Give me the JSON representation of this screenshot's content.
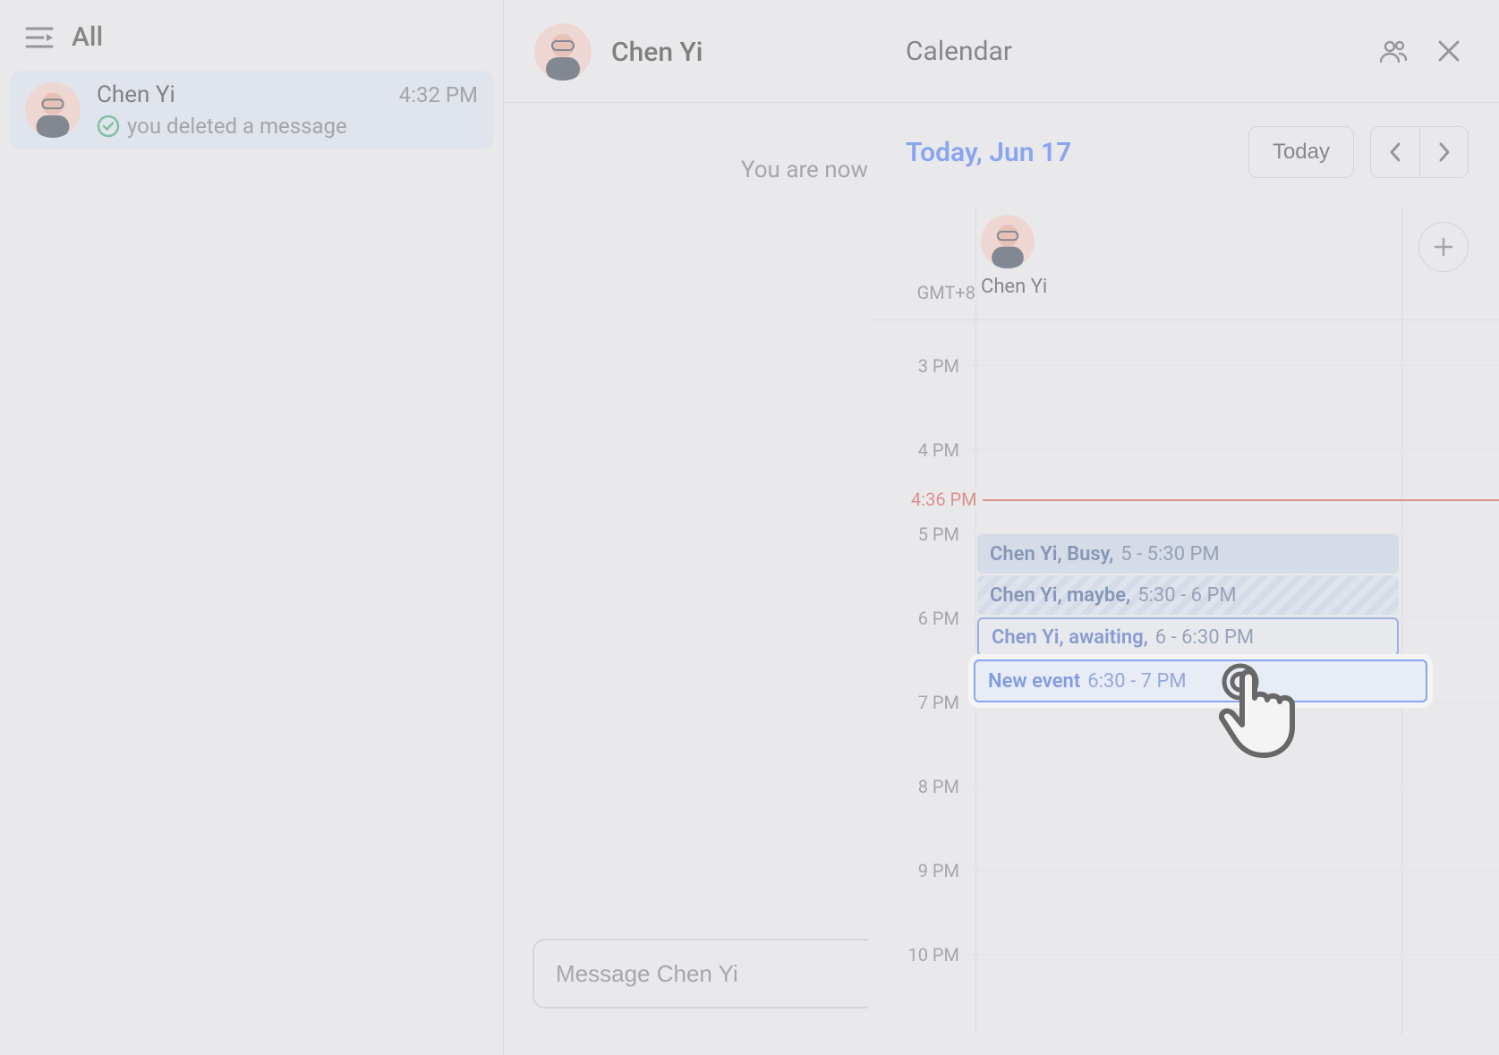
{
  "sidebar": {
    "filter_label": "All",
    "chat": {
      "name": "Chen Yi",
      "time": "4:32 PM",
      "preview": "you deleted a message"
    }
  },
  "conversation": {
    "name": "Chen Yi",
    "system_message": "You are now",
    "compose_placeholder": "Message Chen Yi"
  },
  "calendar": {
    "title": "Calendar",
    "date_label": "Today, Jun 17",
    "today_button": "Today",
    "timezone": "GMT+8",
    "person_name": "Chen Yi",
    "now_label": "4:36 PM",
    "hours": [
      "3 PM",
      "4 PM",
      "5 PM",
      "6 PM",
      "7 PM",
      "8 PM",
      "9 PM",
      "10 PM"
    ],
    "events": {
      "busy": {
        "title": "Chen Yi, Busy,",
        "time": "5 - 5:30 PM"
      },
      "maybe": {
        "title": "Chen Yi, maybe,",
        "time": "5:30 - 6 PM"
      },
      "await": {
        "title": "Chen Yi, awaiting,",
        "time": "6 - 6:30 PM"
      },
      "newevt": {
        "title": "New event",
        "time": "6:30 - 7 PM"
      }
    }
  }
}
